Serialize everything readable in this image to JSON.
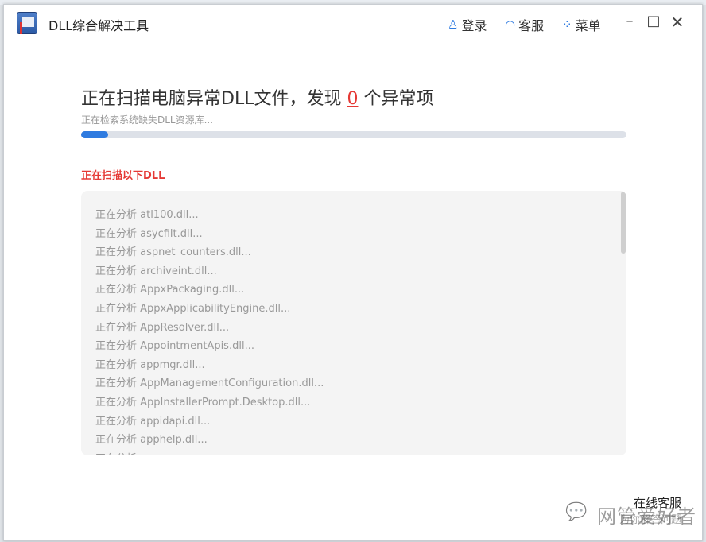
{
  "app": {
    "title": "DLL综合解决工具"
  },
  "toolbar": {
    "login": "登录",
    "service": "客服",
    "menu": "菜单"
  },
  "scan": {
    "heading_prefix": "正在扫描电脑异常DLL文件，发现",
    "count": "0",
    "heading_suffix": "个异常项",
    "status": "正在检索系统缺失DLL资源库...",
    "progress_percent": 5,
    "list_title": "正在扫描以下DLL",
    "items": [
      "正在分析 atl100.dll...",
      "正在分析 asycfilt.dll...",
      "正在分析 aspnet_counters.dll...",
      "正在分析 archiveint.dll...",
      "正在分析 AppxPackaging.dll...",
      "正在分析 AppxApplicabilityEngine.dll...",
      "正在分析 AppResolver.dll...",
      "正在分析 AppointmentApis.dll...",
      "正在分析 appmgr.dll...",
      "正在分析 AppManagementConfiguration.dll...",
      "正在分析 AppInstallerPrompt.Desktop.dll...",
      "正在分析 appidapi.dll...",
      "正在分析 apphelp.dll...",
      "正在分析"
    ]
  },
  "online_service": {
    "title": "在线客服",
    "subtitle": "为你解答问题"
  },
  "watermark": "网管爱好者",
  "colors": {
    "accent": "#2f7be0",
    "alert": "#e53935"
  }
}
